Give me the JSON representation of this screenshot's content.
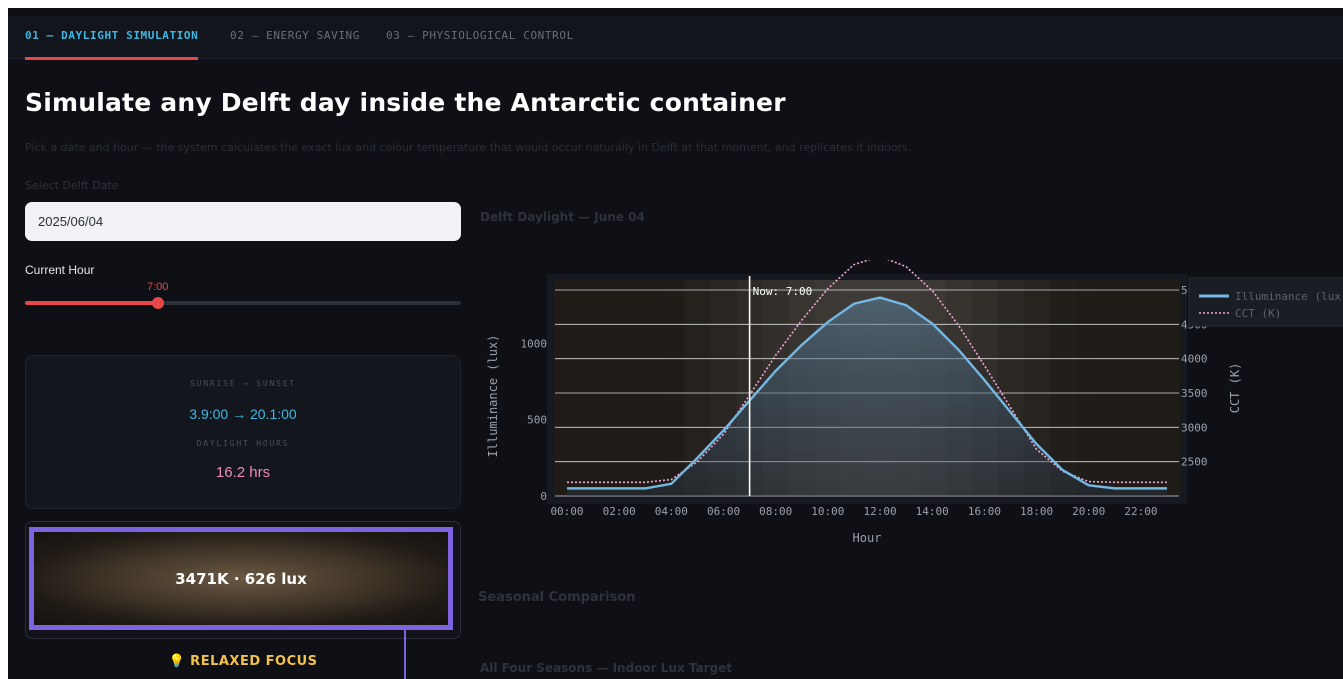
{
  "tabs": [
    {
      "label": "01 — DAYLIGHT SIMULATION",
      "active": true
    },
    {
      "label": "02 — ENERGY SAVING",
      "active": false
    },
    {
      "label": "03 — PHYSIOLOGICAL CONTROL",
      "active": false
    }
  ],
  "header": {
    "title": "Simulate any Delft day inside the Antarctic container",
    "subtitle": "Pick a date and hour — the system calculates the exact lux and colour temperature that would occur naturally in Delft at that moment, and replicates it indoors."
  },
  "controls": {
    "date_label": "Select Delft Date",
    "date_value": "2025/06/04",
    "hour_label": "Current Hour",
    "hour_value_text": "7:00",
    "hour_value": 7,
    "hour_min": 0,
    "hour_max": 23
  },
  "sun_card": {
    "caption1": "SUNRISE → SUNSET",
    "times": "3.9:00 → 20.1:00",
    "caption2": "DAYLIGHT HOURS",
    "hours": "16.2 hrs"
  },
  "light_card": {
    "text": "3471K · 626 lux",
    "mode_icon": "bulb-icon",
    "mode": "💡 RELAXED FOCUS",
    "border_color": "#7d63e0"
  },
  "colors": {
    "accent": "#e8474a",
    "cyan": "#3fb7e0",
    "pink": "#f08bb8",
    "gold": "#f2c14e"
  },
  "chart_title": "Delft Daylight — June 04",
  "chart_data": {
    "type": "line",
    "x": [
      "00:00",
      "01:00",
      "02:00",
      "03:00",
      "04:00",
      "05:00",
      "06:00",
      "07:00",
      "08:00",
      "09:00",
      "10:00",
      "11:00",
      "12:00",
      "13:00",
      "14:00",
      "15:00",
      "16:00",
      "17:00",
      "18:00",
      "19:00",
      "20:00",
      "21:00",
      "22:00",
      "23:00"
    ],
    "x_ticks": [
      "00:00",
      "02:00",
      "04:00",
      "06:00",
      "08:00",
      "10:00",
      "12:00",
      "14:00",
      "16:00",
      "18:00",
      "20:00",
      "22:00"
    ],
    "xlabel": "Hour",
    "ylabel": "Illuminance (lux)",
    "y2label": "CCT (K)",
    "ylim": [
      0,
      1350
    ],
    "y_ticks": [
      0,
      500,
      1000
    ],
    "y2lim": [
      2000,
      5000
    ],
    "y2_ticks": [
      2500,
      3000,
      3500,
      4000,
      4500,
      5000
    ],
    "series": [
      {
        "name": "Illuminance (lux)",
        "axis": "left",
        "style": "solid",
        "color": "#74b8e6",
        "values": [
          50,
          50,
          50,
          50,
          80,
          250,
          430,
          626,
          820,
          990,
          1140,
          1260,
          1300,
          1250,
          1130,
          960,
          760,
          550,
          340,
          170,
          70,
          50,
          50,
          50
        ]
      },
      {
        "name": "CCT (K)",
        "axis": "right",
        "style": "dotted",
        "color": "#f0a8d8",
        "values": [
          2200,
          2200,
          2200,
          2200,
          2240,
          2500,
          2900,
          3471,
          4050,
          4560,
          5020,
          5370,
          5490,
          5340,
          4990,
          4490,
          3900,
          3290,
          2680,
          2360,
          2210,
          2200,
          2200,
          2200
        ]
      }
    ],
    "annotation": "Now: 7:00",
    "now_hour": 7,
    "grid": true,
    "legend": "top-right"
  },
  "sections": {
    "seasonal": "Seasonal Comparison",
    "four_seasons": "All Four Seasons — Indoor Lux Target"
  }
}
